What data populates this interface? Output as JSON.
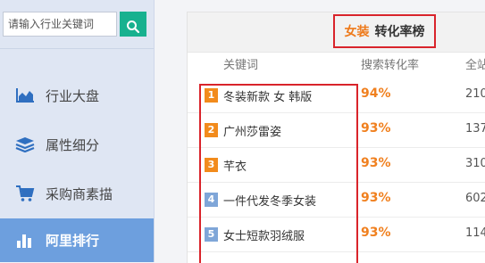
{
  "search": {
    "placeholder": "请输入行业关键词"
  },
  "sidebar": {
    "items": [
      {
        "label": "行业大盘",
        "icon": "area-chart-icon"
      },
      {
        "label": "属性细分",
        "icon": "layers-icon"
      },
      {
        "label": "采购商素描",
        "icon": "shopping-cart-icon"
      },
      {
        "label": "阿里排行",
        "icon": "bar-chart-icon",
        "active": true
      }
    ]
  },
  "panel": {
    "title_category": "女装",
    "title_text": "转化率榜",
    "columns": {
      "keyword": "关键词",
      "rate": "搜索转化率",
      "third": "全站"
    },
    "rows": [
      {
        "rank": "1",
        "keyword": "冬装新款 女 韩版",
        "rate": "94%",
        "value": "210"
      },
      {
        "rank": "2",
        "keyword": "广州莎雷姿",
        "rate": "93%",
        "value": "137"
      },
      {
        "rank": "3",
        "keyword": "芊衣",
        "rate": "93%",
        "value": "310"
      },
      {
        "rank": "4",
        "keyword": "一件代发冬季女装",
        "rate": "93%",
        "value": "602"
      },
      {
        "rank": "5",
        "keyword": "女士短款羽绒服",
        "rate": "93%",
        "value": "114"
      }
    ]
  },
  "colors": {
    "accent_green": "#17b18f",
    "active_nav": "#6d9fde",
    "highlight_red": "#d9242b",
    "rate_orange": "#f0801f"
  }
}
